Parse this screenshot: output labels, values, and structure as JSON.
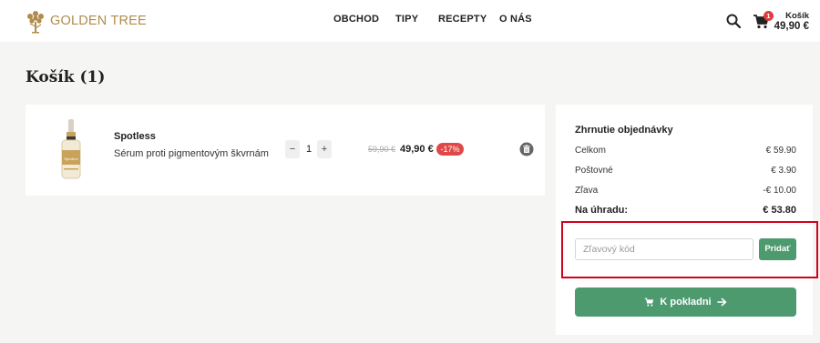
{
  "brand": {
    "name": "GOLDEN TREE",
    "color": "#b08c4c"
  },
  "nav": {
    "items": [
      "OBCHOD",
      "TIPY",
      "RECEPTY",
      "O NÁS"
    ]
  },
  "header": {
    "cart_badge": "1",
    "cart_label": "Košík",
    "cart_total": "49,90 €"
  },
  "page": {
    "title": "Košík (1)"
  },
  "cart": {
    "items": [
      {
        "name": "Spotless",
        "description": "Sérum proti pigmentovým škvrnám",
        "quantity": "1",
        "qty_minus": "−",
        "qty_plus": "+",
        "old_price": "59,90 €",
        "price": "49,90 €",
        "discount": "-17%",
        "image_label": "Spotless"
      }
    ]
  },
  "summary": {
    "title": "Zhrnutie objednávky",
    "rows": [
      {
        "label": "Celkom",
        "value": "€ 59.90"
      },
      {
        "label": "Poštovné",
        "value": "€ 3.90"
      },
      {
        "label": "Zľava",
        "value": "-€ 10.00"
      },
      {
        "label": "Na úhradu:",
        "value": "€ 53.80"
      }
    ],
    "coupon_placeholder": "Zľavový kód",
    "coupon_button": "Pridať",
    "checkout_label": "K pokladni"
  },
  "colors": {
    "accent_green": "#4e9a6f",
    "badge_red": "#e04848",
    "highlight": "#d0021b"
  }
}
